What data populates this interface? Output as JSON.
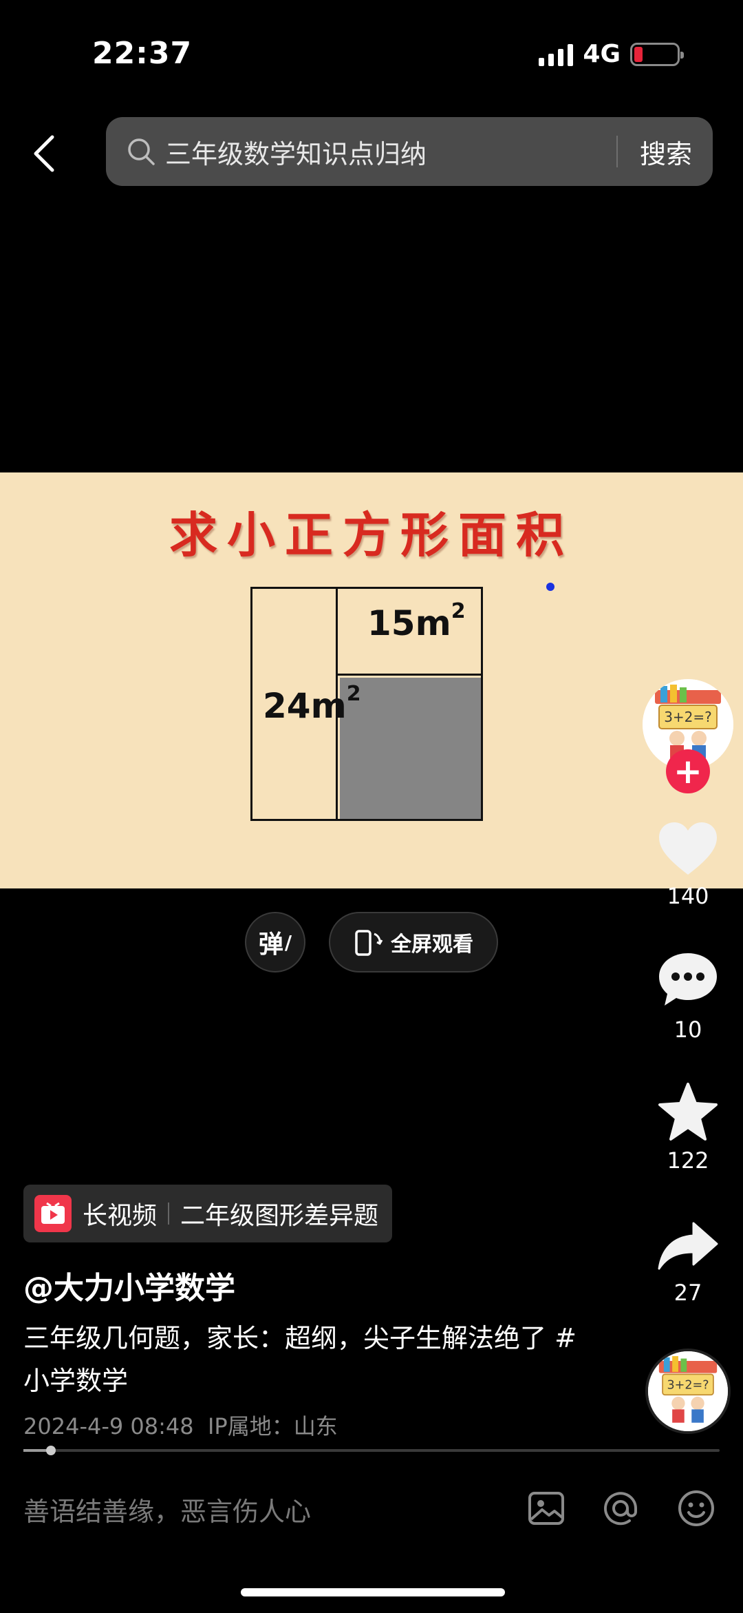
{
  "status_bar": {
    "time": "22:37",
    "network": "4G"
  },
  "search": {
    "query": "三年级数学知识点归纳",
    "button": "搜索"
  },
  "video": {
    "title": "求小正方形面积",
    "label_top": "15m",
    "label_left": "24m",
    "unit_sup": "2"
  },
  "controls": {
    "danmu": "弹",
    "fullscreen": "全屏观看"
  },
  "actions": {
    "likes": "140",
    "comments": "10",
    "favorites": "122",
    "shares": "27"
  },
  "long_video": {
    "label": "长视频",
    "title": "二年级图形差异题"
  },
  "author": {
    "username": "@大力小学数学"
  },
  "description": "三年级几何题，家长：超纲，尖子生解法绝了 #小学数学",
  "meta": {
    "date": "2024-4-9 08:48",
    "ip": "IP属地：山东"
  },
  "progress": {
    "fraction": 0.04
  },
  "comment": {
    "placeholder": "善语结善缘，恶言伤人心"
  },
  "avatar_text": "3+2=?",
  "colors": {
    "accent": "#f0264c",
    "video_bg": "#f7e2bb",
    "title_red": "#d82a20"
  }
}
